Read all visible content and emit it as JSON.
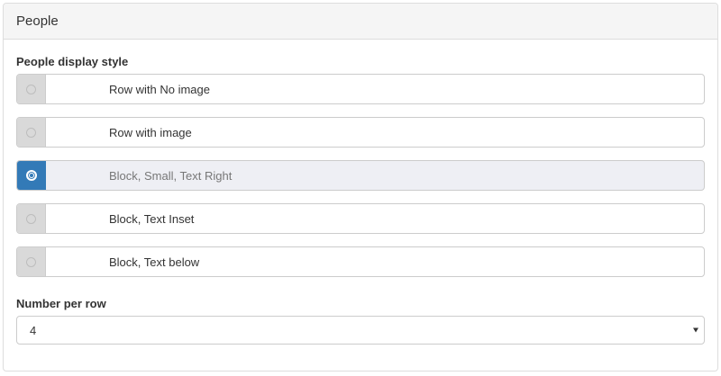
{
  "panel": {
    "title": "People"
  },
  "display_style": {
    "label": "People display style",
    "options": [
      {
        "label": "Row with No image",
        "selected": false
      },
      {
        "label": "Row with image",
        "selected": false
      },
      {
        "label": "Block, Small, Text Right",
        "selected": true
      },
      {
        "label": "Block, Text Inset",
        "selected": false
      },
      {
        "label": "Block, Text below",
        "selected": false
      }
    ]
  },
  "number_per_row": {
    "label": "Number per row",
    "value": "4"
  },
  "colors": {
    "accent": "#337ab7",
    "selected_row_bg": "#eeeff4",
    "addon_bg": "#d9d9d9"
  }
}
